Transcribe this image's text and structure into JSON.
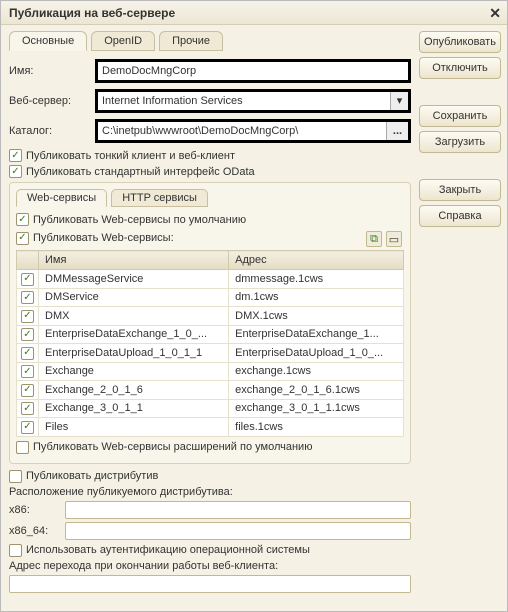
{
  "title": "Публикация на веб-сервере",
  "buttons": {
    "publish": "Опубликовать",
    "disconnect": "Отключить",
    "save": "Сохранить",
    "load": "Загрузить",
    "close": "Закрыть",
    "help": "Справка"
  },
  "tabs": {
    "main": "Основные",
    "openid": "OpenID",
    "other": "Прочие"
  },
  "form": {
    "name_label": "Имя:",
    "name_value": "DemoDocMngCorp",
    "webserver_label": "Веб-сервер:",
    "webserver_value": "Internet Information Services",
    "catalog_label": "Каталог:",
    "catalog_value": "C:\\inetpub\\wwwroot\\DemoDocMngCorp\\"
  },
  "checks": {
    "thinclient": "Публиковать тонкий клиент и веб-клиент",
    "odata": "Публиковать стандартный интерфейс OData"
  },
  "subtabs": {
    "web": "Web-сервисы",
    "http": "HTTP сервисы"
  },
  "ws": {
    "pub_default": "Публиковать Web-сервисы по умолчанию",
    "pub_ws": "Публиковать Web-сервисы:",
    "col_name": "Имя",
    "col_addr": "Адрес",
    "rows": [
      {
        "n": "DMMessageService",
        "a": "dmmessage.1cws"
      },
      {
        "n": "DMService",
        "a": "dm.1cws"
      },
      {
        "n": "DMX",
        "a": "DMX.1cws"
      },
      {
        "n": "EnterpriseDataExchange_1_0_...",
        "a": "EnterpriseDataExchange_1..."
      },
      {
        "n": "EnterpriseDataUpload_1_0_1_1",
        "a": "EnterpriseDataUpload_1_0_..."
      },
      {
        "n": "Exchange",
        "a": "exchange.1cws"
      },
      {
        "n": "Exchange_2_0_1_6",
        "a": "exchange_2_0_1_6.1cws"
      },
      {
        "n": "Exchange_3_0_1_1",
        "a": "exchange_3_0_1_1.1cws"
      },
      {
        "n": "Files",
        "a": "files.1cws"
      }
    ],
    "pub_ext": "Публиковать Web-сервисы расширений по умолчанию"
  },
  "dist": {
    "publish": "Публиковать дистрибутив",
    "location": "Расположение публикуемого дистрибутива:",
    "x86": "x86:",
    "x86_64": "x86_64:"
  },
  "auth": "Использовать аутентификацию операционной системы",
  "exit_url": "Адрес перехода при окончании работы веб-клиента:"
}
